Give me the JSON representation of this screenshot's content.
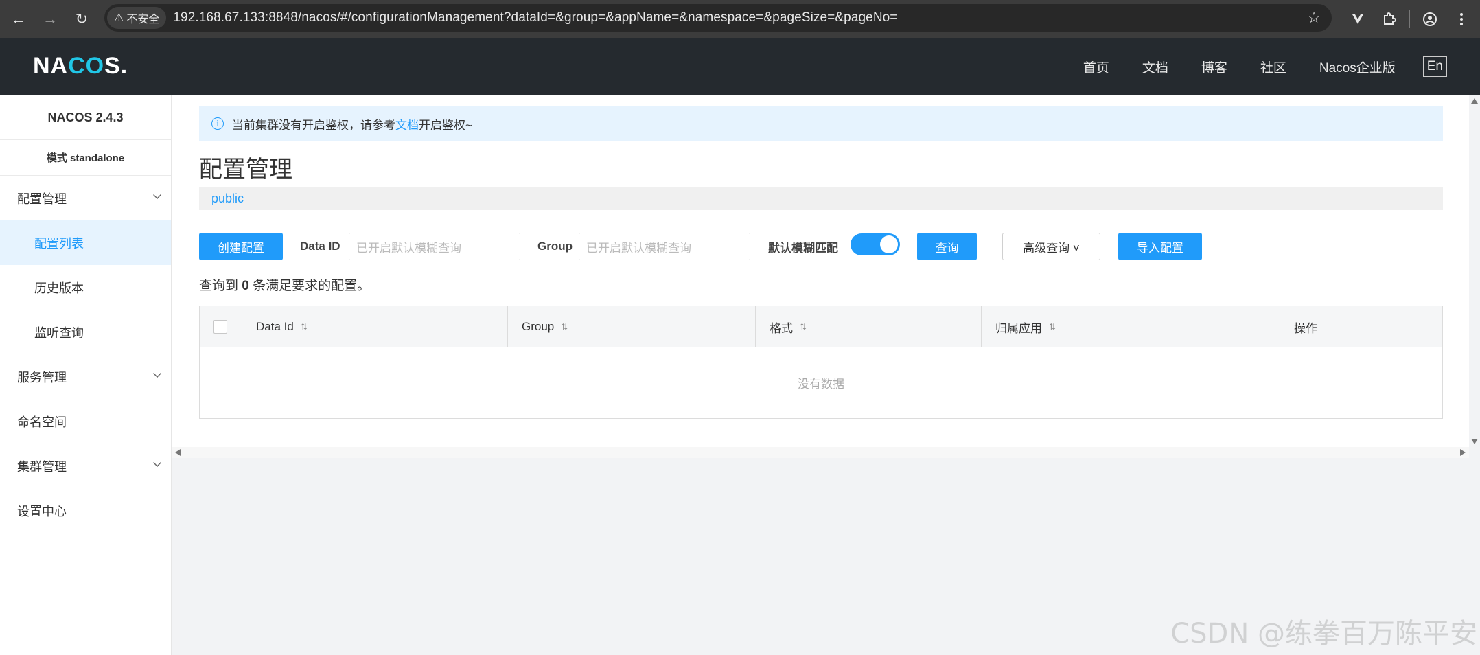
{
  "browser": {
    "back_icon": "←",
    "forward_icon": "→",
    "reload_icon": "↻",
    "insecure_icon": "⚠",
    "insecure_label": "不安全",
    "url": "192.168.67.133:8848/nacos/#/configurationManagement?dataId=&group=&appName=&namespace=&pageSize=&pageNo=",
    "star_icon": "☆"
  },
  "topnav": {
    "logo_left": "NA",
    "logo_o": "CO",
    "logo_right": "S.",
    "links": [
      "首页",
      "文档",
      "博客",
      "社区",
      "Nacos企业版"
    ],
    "lang": "En"
  },
  "sidebar": {
    "version": "NACOS 2.4.3",
    "mode": "模式 standalone",
    "items": [
      {
        "label": "配置管理"
      },
      {
        "label": "配置列表"
      },
      {
        "label": "历史版本"
      },
      {
        "label": "监听查询"
      },
      {
        "label": "服务管理"
      },
      {
        "label": "命名空间"
      },
      {
        "label": "集群管理"
      },
      {
        "label": "设置中心"
      }
    ]
  },
  "notice": {
    "icon": "i",
    "text_before": "当前集群没有开启鉴权，请参考",
    "link": "文档",
    "text_after": "开启鉴权~"
  },
  "page_title": "配置管理",
  "namespace": "public",
  "filter": {
    "create_label": "创建配置",
    "dataid_label": "Data ID",
    "dataid_placeholder": "已开启默认模糊查询",
    "group_label": "Group",
    "group_placeholder": "已开启默认模糊查询",
    "fuzzy_label": "默认模糊匹配",
    "fuzzy_on": true,
    "query_label": "查询",
    "advanced_label": "高级查询 ˅",
    "import_label": "导入配置"
  },
  "result": {
    "prefix": "查询到",
    "count": "0",
    "suffix": "条满足要求的配置。"
  },
  "table": {
    "columns": [
      "Data Id",
      "Group",
      "格式",
      "归属应用",
      "操作"
    ],
    "sort_icon": "⇅",
    "empty_text": "没有数据"
  },
  "watermark": "CSDN @练拳百万陈平安",
  "colors": {
    "accent": "#209bfa",
    "topnav_bg": "#252a2f",
    "logo_accent": "#21c6e6"
  }
}
